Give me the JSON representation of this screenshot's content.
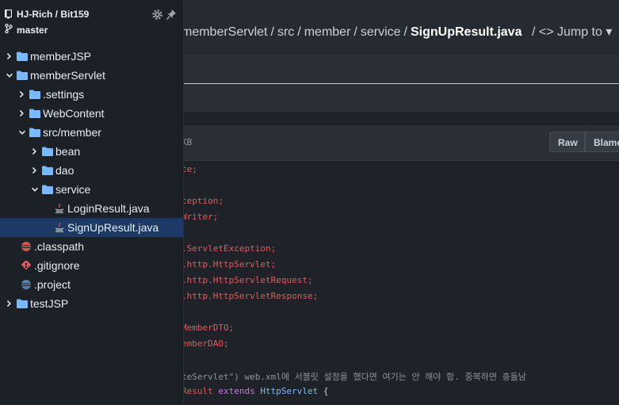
{
  "breadcrumb": {
    "part1": "memberServlet",
    "part2": "src",
    "part3": "member",
    "part4": "service",
    "file": "SignUpResult.java",
    "jump": "Jump to"
  },
  "file_header": {
    "size": "KB",
    "raw_label": "Raw",
    "blame_label": "Blame"
  },
  "code_lines": [
    {
      "text": "ce;",
      "cls": "tok-red"
    },
    {
      "text": "",
      "cls": ""
    },
    {
      "text": "ception;",
      "cls": "tok-red"
    },
    {
      "text": "Writer;",
      "cls": "tok-red"
    },
    {
      "text": "",
      "cls": ""
    },
    {
      "text": ".ServletException;",
      "cls": "tok-red"
    },
    {
      "text": ".http.HttpServlet;",
      "cls": "tok-red"
    },
    {
      "text": ".http.HttpServletRequest;",
      "cls": "tok-red"
    },
    {
      "text": ".http.HttpServletResponse;",
      "cls": "tok-red"
    },
    {
      "text": "",
      "cls": ""
    },
    {
      "text": "MemberDTO;",
      "cls": "tok-red"
    },
    {
      "text": "emberDAO;",
      "cls": "tok-red"
    },
    {
      "text": "",
      "cls": ""
    },
    {
      "text": "teServlet\") web.xml에 서블릿 설정을 했다면 여기는 안 해야 함. 중복하면 충돌남",
      "cls": "tok-comment"
    },
    {
      "text": "Result extends HttpServlet {",
      "cls": "mixed"
    }
  ],
  "sidebar": {
    "repo": "HJ-Rich / Bit159",
    "branch": "master",
    "items": [
      {
        "label": "memberJSP",
        "type": "folder",
        "chevron": "right"
      },
      {
        "label": "memberServlet",
        "type": "folder",
        "chevron": "down"
      },
      {
        "label": ".settings",
        "type": "folder",
        "chevron": "right"
      },
      {
        "label": "WebContent",
        "type": "folder",
        "chevron": "right"
      },
      {
        "label": "src/member",
        "type": "folder",
        "chevron": "down"
      },
      {
        "label": "bean",
        "type": "folder",
        "chevron": "right"
      },
      {
        "label": "dao",
        "type": "folder",
        "chevron": "right"
      },
      {
        "label": "service",
        "type": "folder",
        "chevron": "down"
      },
      {
        "label": "LoginResult.java",
        "type": "java"
      },
      {
        "label": "SignUpResult.java",
        "type": "java",
        "selected": true
      },
      {
        "label": ".classpath",
        "type": "eclipse-red"
      },
      {
        "label": ".gitignore",
        "type": "git"
      },
      {
        "label": ".project",
        "type": "eclipse-blue"
      },
      {
        "label": "testJSP",
        "type": "folder",
        "chevron": "right"
      }
    ]
  },
  "colors": {
    "sidebar_bg": "#1c2127",
    "selected_bg": "#1d3a66",
    "folder": "#7cb8ff",
    "string_red": "#e05b5b"
  }
}
